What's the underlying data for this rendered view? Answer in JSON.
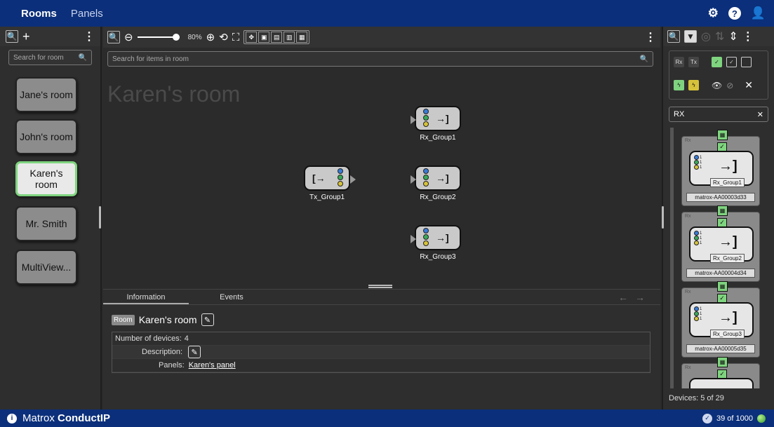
{
  "topbar": {
    "tab_active": "Rooms",
    "tab_inactive": "Panels",
    "gear_icon": "gear-icon",
    "help_icon": "help-icon",
    "user_icon": "user-icon",
    "help_glyph": "?"
  },
  "left": {
    "search_placeholder": "Search for room",
    "rooms": [
      {
        "label": "Jane's room",
        "selected": false
      },
      {
        "label": "John's room",
        "selected": false
      },
      {
        "label": "Karen's room",
        "selected": true
      },
      {
        "label": "Mr. Smith",
        "selected": false
      },
      {
        "label": "MultiView...",
        "selected": false
      }
    ]
  },
  "center": {
    "zoom_label": "80%",
    "zoom_level": 0.8,
    "search_placeholder": "Search for items in room",
    "room_title": "Karen's room",
    "nodes": [
      {
        "label": "Rx_Group1",
        "kind": "rx"
      },
      {
        "label": "Tx_Group1",
        "kind": "tx"
      },
      {
        "label": "Rx_Group2",
        "kind": "rx"
      },
      {
        "label": "Rx_Group3",
        "kind": "rx"
      }
    ],
    "info": {
      "tab_information": "Information",
      "tab_events": "Events",
      "badge": "Room",
      "name": "Karen's room",
      "devices_label": "Number of devices:",
      "devices_value": "4",
      "description_label": "Description:",
      "panels_label": "Panels:",
      "panels_link": "Karen's panel"
    }
  },
  "right": {
    "filter_tag": "RX",
    "devices": [
      {
        "type": "Rx",
        "group": "Rx_Group1",
        "name": "matrox-AA00003d33"
      },
      {
        "type": "Rx",
        "group": "Rx_Group2",
        "name": "matrox-AA00004d34"
      },
      {
        "type": "Rx",
        "group": "Rx_Group3",
        "name": "matrox-AA00005d35"
      },
      {
        "type": "Rx",
        "group": "",
        "name": ""
      }
    ],
    "count_text": "Devices: 5 of 29"
  },
  "bottombar": {
    "brand_light": "Matrox",
    "brand_bold": "ConductIP",
    "status_text": "39 of 1000",
    "info_glyph": "i",
    "shield_glyph": "✓",
    "led_color": "#2f9a2f"
  },
  "colors": {
    "accent": "#0b2f7a",
    "selected_border": "#7fd47f"
  }
}
